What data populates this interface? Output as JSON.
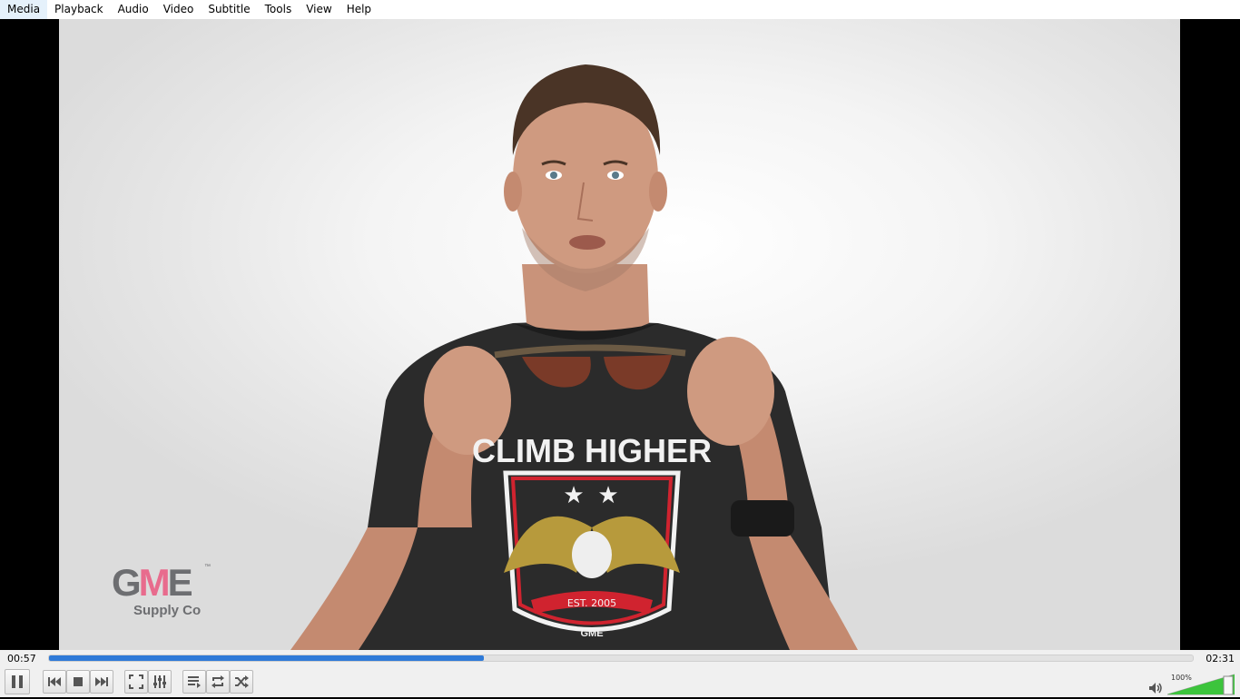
{
  "menu": {
    "items": [
      "Media",
      "Playback",
      "Audio",
      "Video",
      "Subtitle",
      "Tools",
      "View",
      "Help"
    ]
  },
  "video": {
    "shirt_text": "CLIMB HIGHER",
    "badge_text": "EST. 2005",
    "badge_logo_text": "GME",
    "watermark": {
      "logo_g": "G",
      "logo_m": "M",
      "logo_e": "E",
      "trademark": "™",
      "subtitle": "Supply Co"
    }
  },
  "controls": {
    "elapsed": "00:57",
    "total": "02:31",
    "progress_fraction": 0.38,
    "volume_label": "100%",
    "volume_fraction": 1.0,
    "accent_color": "#2f7ad8",
    "volume_color": "#3cc43c",
    "buttons": [
      {
        "name": "pause-button",
        "icon": "pause-icon"
      },
      {
        "name": "previous-button",
        "icon": "skip-back-icon"
      },
      {
        "name": "stop-button",
        "icon": "stop-icon"
      },
      {
        "name": "next-button",
        "icon": "skip-forward-icon"
      },
      {
        "name": "fullscreen-button",
        "icon": "fullscreen-icon"
      },
      {
        "name": "extended-settings-button",
        "icon": "sliders-icon"
      },
      {
        "name": "playlist-button",
        "icon": "playlist-icon"
      },
      {
        "name": "loop-button",
        "icon": "loop-icon"
      },
      {
        "name": "shuffle-button",
        "icon": "shuffle-icon"
      }
    ]
  }
}
